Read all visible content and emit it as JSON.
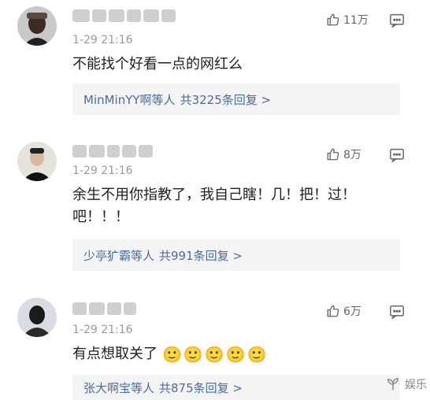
{
  "comments": [
    {
      "time": "1-29 21:16",
      "likes": "11万",
      "text": "不能找个好看一点的网红么",
      "reply_names": "MinMinYY啊等人",
      "reply_count": "共3225条回复 >"
    },
    {
      "time": "1-29 21:16",
      "likes": "8万",
      "text": "余生不用你指教了，我自己瞎！几！把！过！",
      "text2": "吧！！！",
      "reply_names": "少亭犷霸等人",
      "reply_count": "共991条回复 >"
    },
    {
      "time": "1-29 21:16",
      "likes": "6万",
      "text": "有点想取关了",
      "emoji": "🙂🙂🙂🙂🙂",
      "reply_names": "张大啊宝等人",
      "reply_count": "共875条回复 >"
    }
  ],
  "watermark": "娱乐",
  "colors": {
    "link": "#4b6d9c",
    "reply_bg": "#f4f4f4",
    "time": "#9a9a9a"
  }
}
